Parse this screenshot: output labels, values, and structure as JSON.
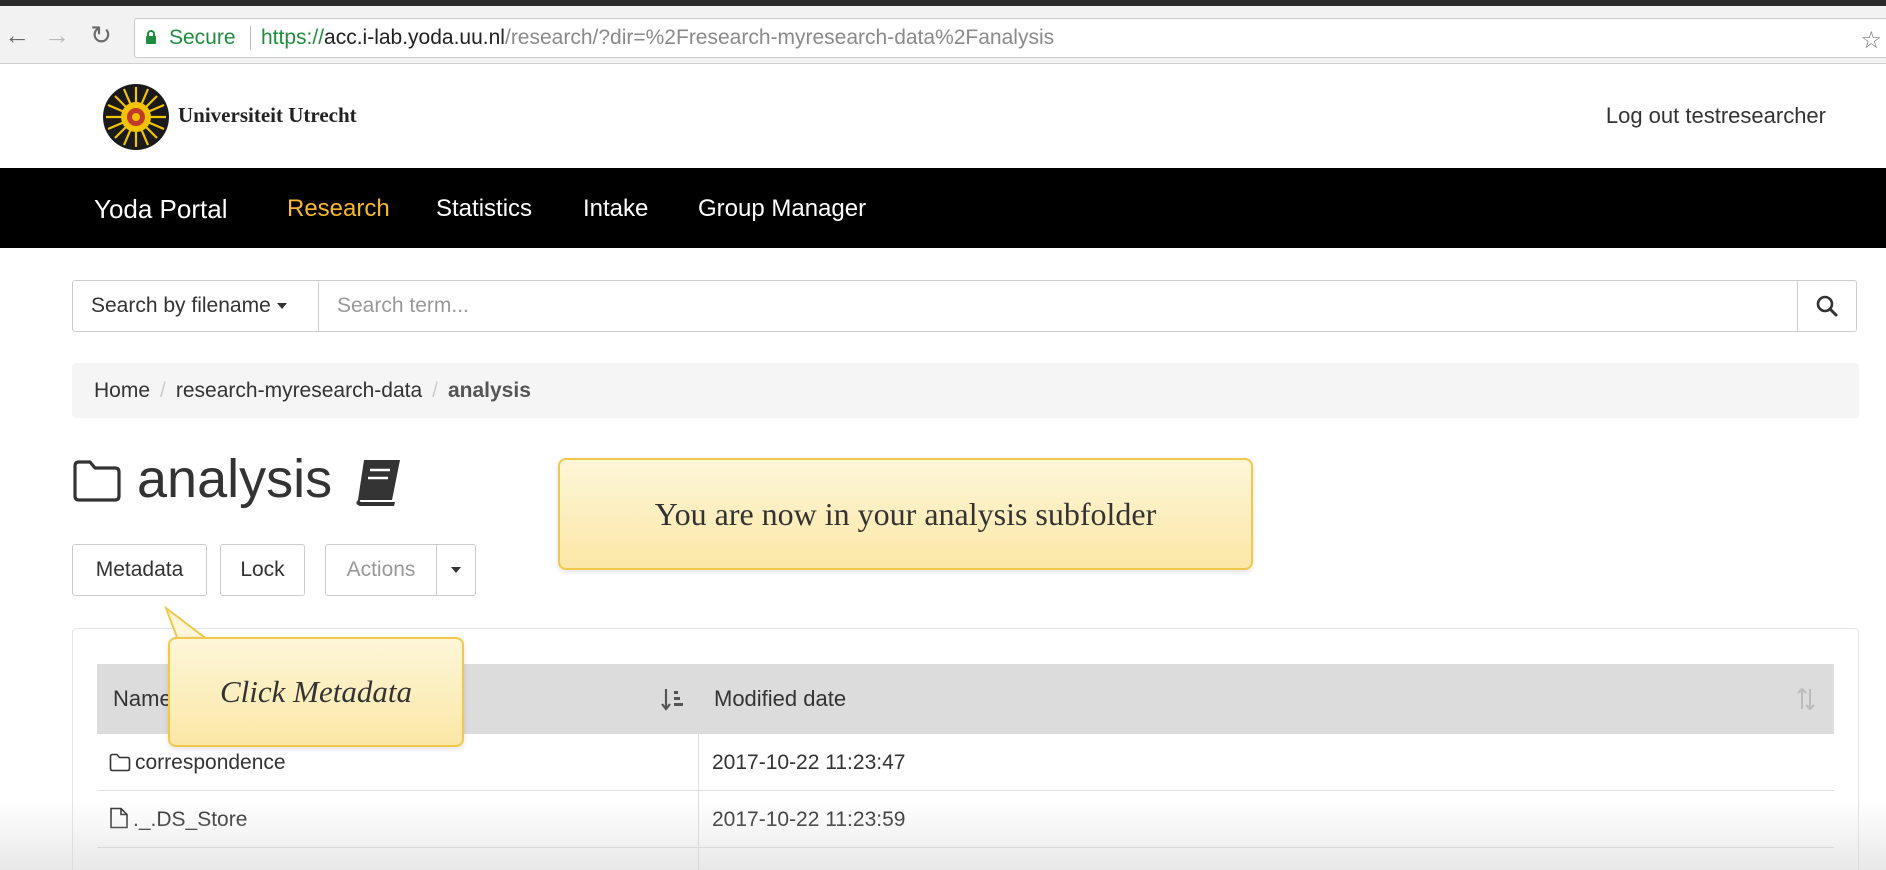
{
  "browser": {
    "secure_label": "Secure",
    "url_scheme": "https://",
    "url_host": "acc.i-lab.yoda.uu.nl",
    "url_path": "/research/?dir=%2Fresearch-myresearch-data%2Fanalysis"
  },
  "header": {
    "university_name": "Universiteit Utrecht",
    "logout_label": "Log out testresearcher"
  },
  "navbar": {
    "brand": "Yoda Portal",
    "items": [
      {
        "label": "Research",
        "active": true
      },
      {
        "label": "Statistics",
        "active": false
      },
      {
        "label": "Intake",
        "active": false
      },
      {
        "label": "Group Manager",
        "active": false
      }
    ]
  },
  "search": {
    "type_label": "Search by filename",
    "placeholder": "Search term..."
  },
  "breadcrumb": {
    "items": [
      "Home",
      "research-myresearch-data",
      "analysis"
    ]
  },
  "page": {
    "title": "analysis"
  },
  "actions": {
    "metadata_label": "Metadata",
    "lock_label": "Lock",
    "actions_label": "Actions"
  },
  "table": {
    "columns": [
      "Name",
      "Modified date"
    ],
    "rows": [
      {
        "name": "correspondence",
        "type": "folder",
        "modified": "2017-10-22 11:23:47"
      },
      {
        "name": "._.DS_Store",
        "type": "file",
        "modified": "2017-10-22 11:23:59"
      }
    ]
  },
  "tour": {
    "main_message": "You are now in your analysis subfolder",
    "hint": "Click Metadata"
  },
  "colors": {
    "nav_active": "#f5b82e",
    "secure_green": "#1e8e3e",
    "popover_border": "#f1c84a"
  }
}
